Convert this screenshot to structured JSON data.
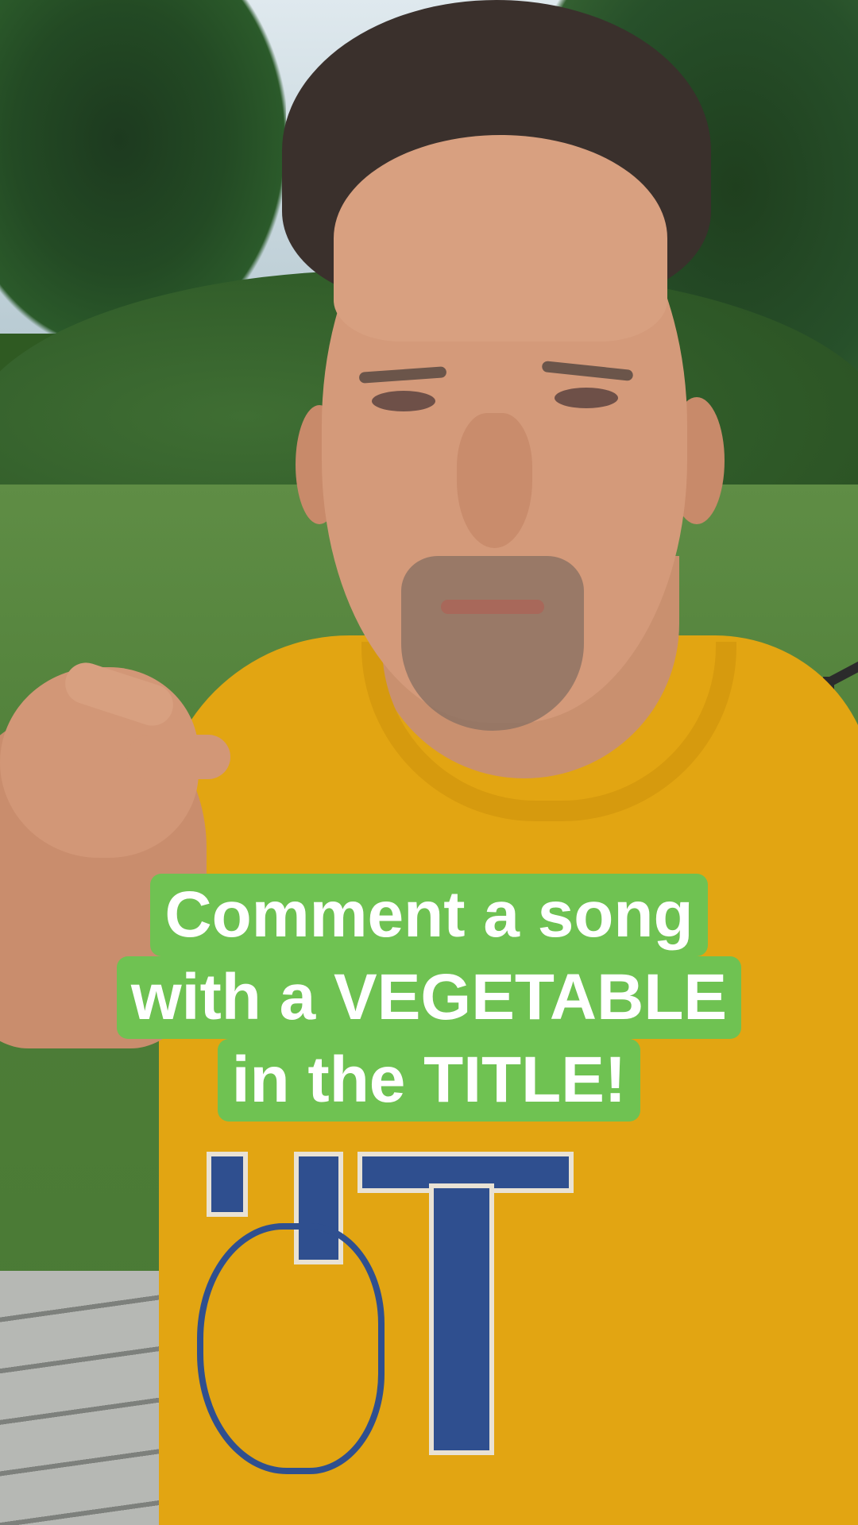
{
  "video": {
    "scene": "selfie video frame",
    "caption": {
      "lines": [
        "Comment a song",
        "with a VEGETABLE",
        "in the TITLE!"
      ],
      "background_color": "#6fc252",
      "text_color": "#ffffff"
    }
  }
}
